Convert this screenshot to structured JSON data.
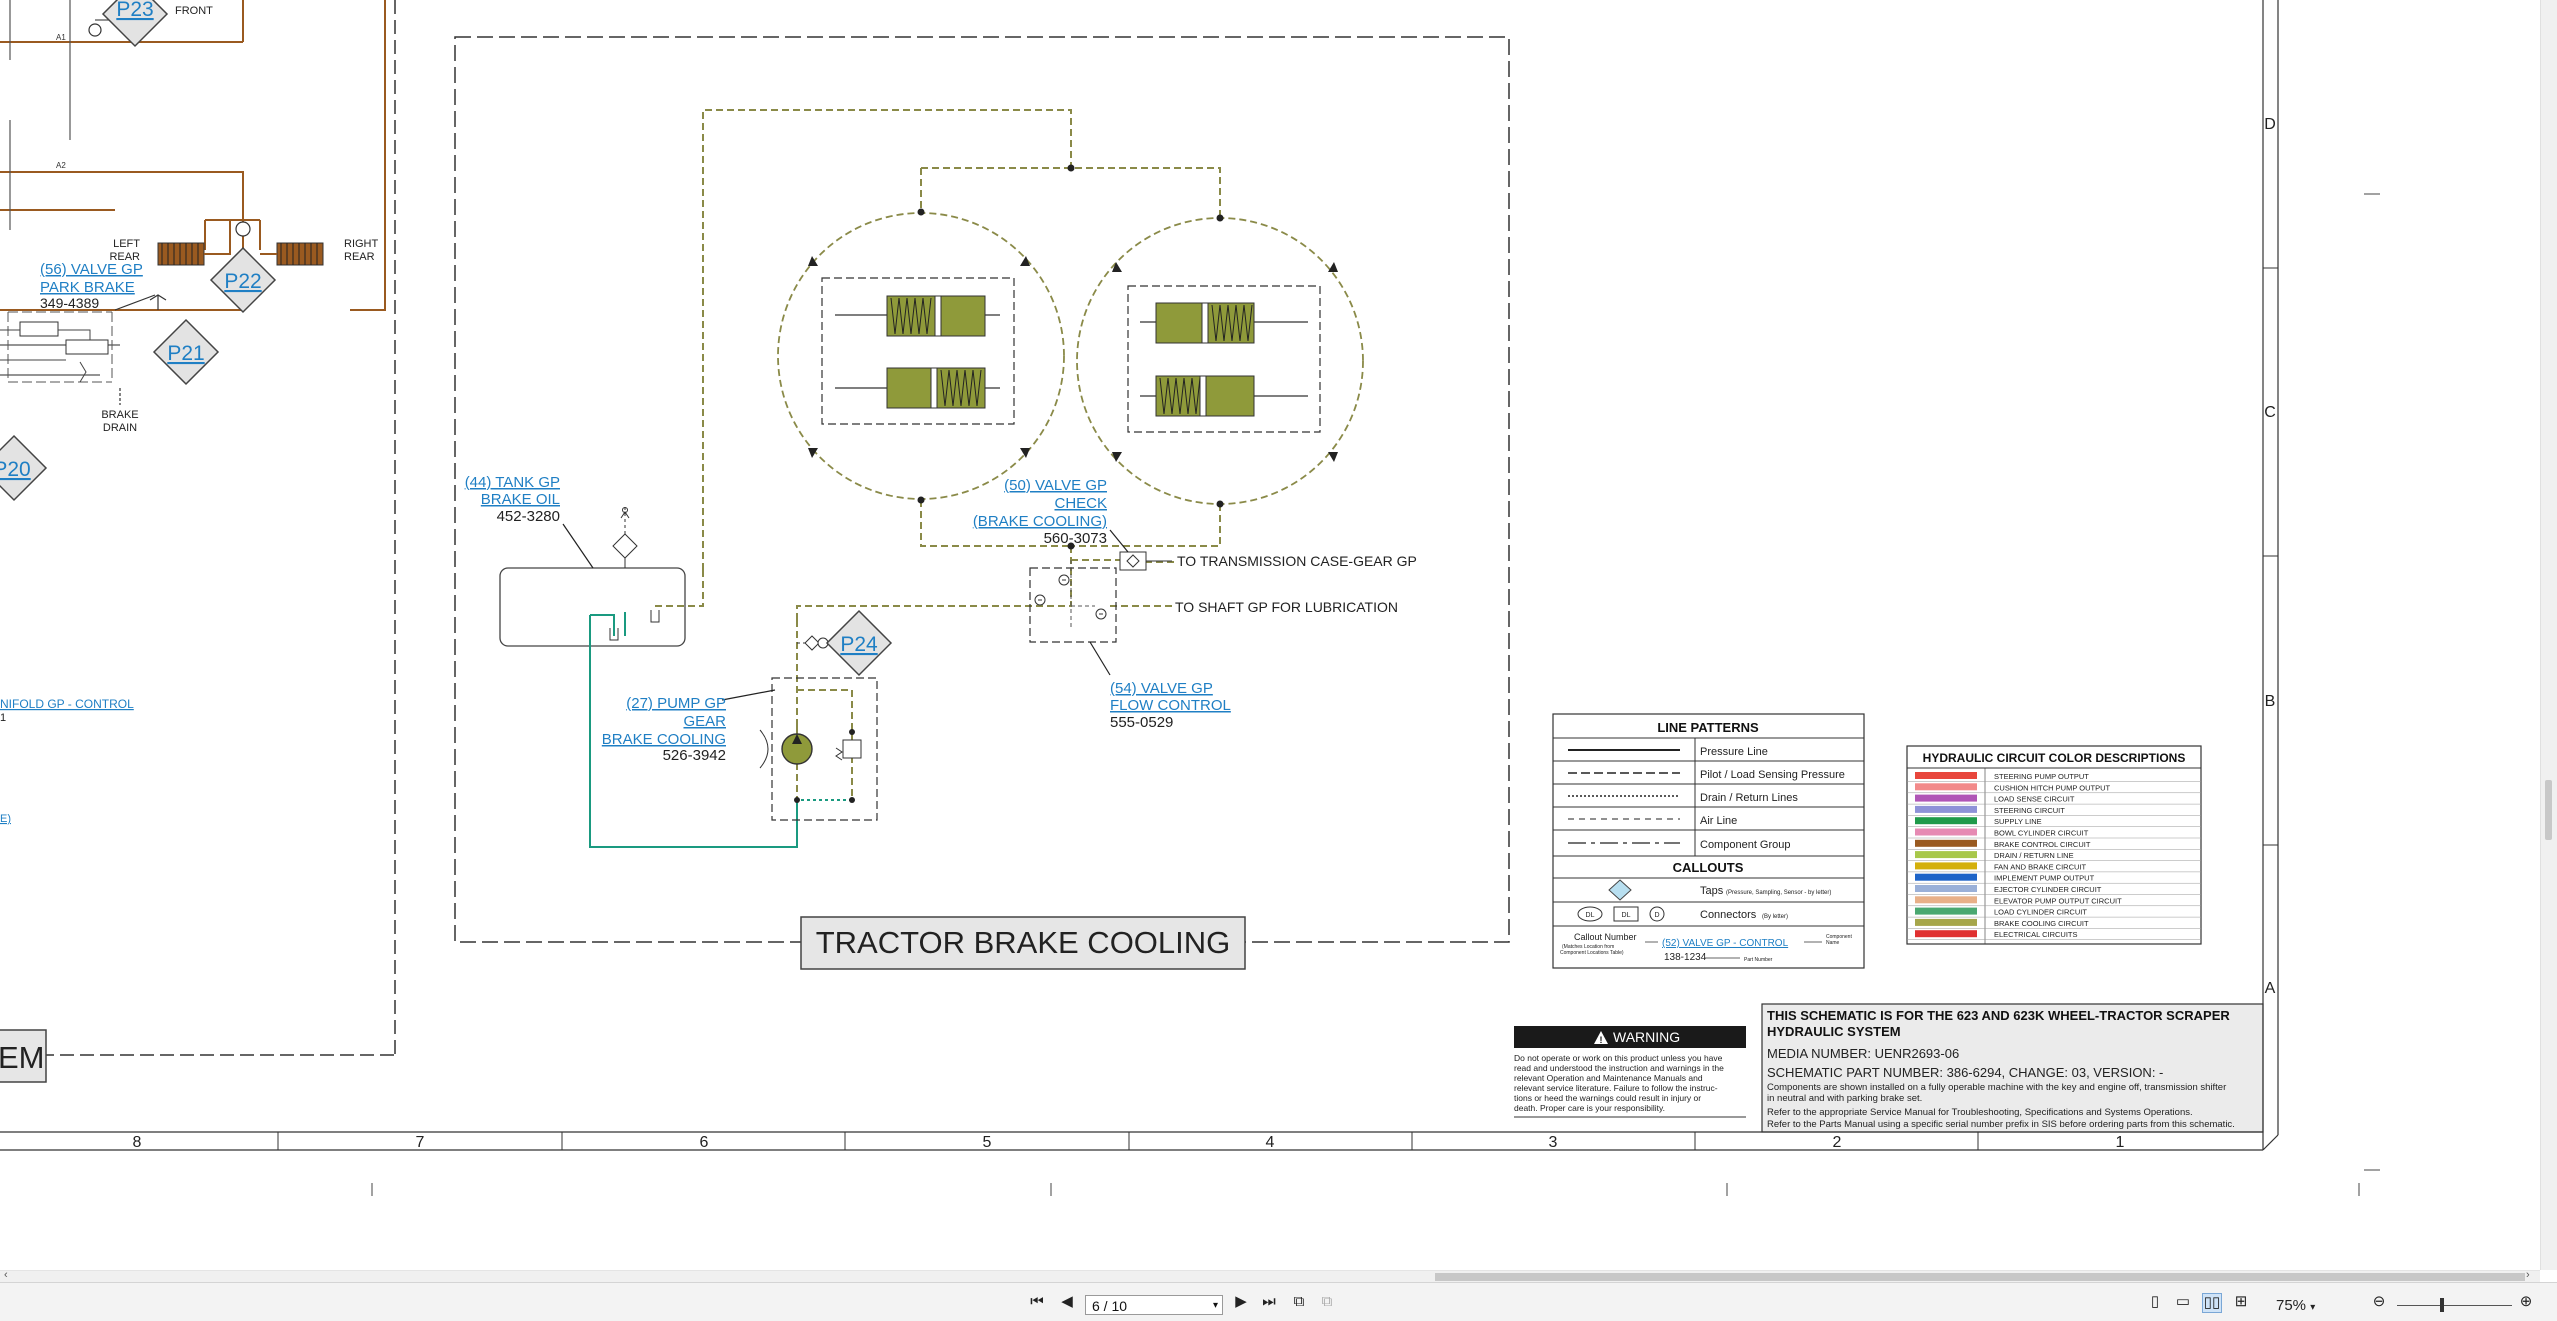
{
  "schematic": {
    "title_box": "TRACTOR BRAKE COOLING",
    "left_fragment_label": "EM",
    "taps": {
      "p23": "P23",
      "p22": "P22",
      "p21": "P21",
      "p20": "P20",
      "p24": "P24"
    },
    "left_side": {
      "front": "FRONT",
      "left_rear": [
        "LEFT",
        "REAR"
      ],
      "right_rear": [
        "RIGHT",
        "REAR"
      ],
      "valve_park_brake": [
        "(56) VALVE GP",
        "PARK BRAKE"
      ],
      "valve_park_brake_part": "349-4389",
      "brake_drain": [
        "BRAKE",
        "DRAIN"
      ],
      "manifold_link": "NIFOLD GP - CONTROL",
      "manifold_suffix": "1",
      "link_fragment": "E)",
      "wire_tags": [
        "A1",
        "A2"
      ]
    },
    "components": {
      "tank": {
        "lines": [
          "(44) TANK GP",
          "BRAKE OIL"
        ],
        "part": "452-3280"
      },
      "check_valve": {
        "lines": [
          "(50) VALVE GP",
          "CHECK",
          "(BRAKE COOLING)"
        ],
        "part": "560-3073"
      },
      "pump": {
        "lines": [
          "(27) PUMP GP",
          "GEAR",
          "BRAKE COOLING"
        ],
        "part": "526-3942"
      },
      "flow_valve": {
        "lines": [
          "(54) VALVE GP",
          "FLOW CONTROL"
        ],
        "part": "555-0529"
      }
    },
    "destinations": {
      "transmission": "TO TRANSMISSION CASE-GEAR GP",
      "shaft": "TO SHAFT GP FOR LUBRICATION"
    },
    "line_patterns": {
      "title": "LINE PATTERNS",
      "rows": [
        "Pressure Line",
        "Pilot / Load Sensing Pressure",
        "Drain / Return Lines",
        "Air Line",
        "Component Group"
      ],
      "callouts_title": "CALLOUTS",
      "taps_label": "Taps",
      "taps_note": "(Pressure, Sampling, Sensor - by letter)",
      "connectors_label": "Connectors",
      "connectors_note": "(By letter)",
      "connector_tags": [
        "DL",
        "DL",
        "D"
      ],
      "callout_number": "Callout Number",
      "callout_number_note": [
        "(Matches Location from",
        "Component Locations Table)"
      ],
      "callout_example": "(52) VALVE GP - CONTROL",
      "callout_part": "138-1234",
      "part_number_label": "Part Number",
      "component_name_label": [
        "Component",
        "Name"
      ]
    },
    "color_descriptions": {
      "title": "HYDRAULIC CIRCUIT COLOR DESCRIPTIONS",
      "items": [
        {
          "label": "STEERING PUMP OUTPUT",
          "color": "#e8463c"
        },
        {
          "label": "CUSHION HITCH PUMP OUTPUT",
          "color": "#f28a8a"
        },
        {
          "label": "LOAD SENSE CIRCUIT",
          "color": "#b056b6"
        },
        {
          "label": "STEERING CIRCUIT",
          "color": "#8e92d8"
        },
        {
          "label": "SUPPLY LINE",
          "color": "#1f9a4a"
        },
        {
          "label": "BOWL CYLINDER CIRCUIT",
          "color": "#e68ab3"
        },
        {
          "label": "BRAKE CONTROL CIRCUIT",
          "color": "#9a5a20"
        },
        {
          "label": "DRAIN / RETURN LINE",
          "color": "#a8c84a"
        },
        {
          "label": "FAN AND BRAKE CIRCUIT",
          "color": "#d4b00c"
        },
        {
          "label": "IMPLEMENT PUMP OUTPUT",
          "color": "#1e64c8"
        },
        {
          "label": "EJECTOR CYLINDER CIRCUIT",
          "color": "#9ab0d8"
        },
        {
          "label": "ELEVATOR PUMP OUTPUT CIRCUIT",
          "color": "#e8b088"
        },
        {
          "label": "LOAD CYLINDER CIRCUIT",
          "color": "#4aa870"
        },
        {
          "label": "BRAKE COOLING CIRCUIT",
          "color": "#a6a64a"
        },
        {
          "label": "ELECTRICAL CIRCUITS",
          "color": "#e03030"
        }
      ]
    },
    "warning": {
      "title": "WARNING",
      "lines": [
        "Do not operate or work on this product unless you have",
        "read and understood the instruction and warnings in the",
        "relevant Operation and Maintenance Manuals and",
        "relevant service literature. Failure to follow the instruc-",
        "tions or heed the warnings could result in injury or",
        "death. Proper care is your responsibility."
      ]
    },
    "info_block": {
      "heading": [
        "THIS SCHEMATIC IS FOR THE 623 AND 623K WHEEL-TRACTOR SCRAPER",
        "HYDRAULIC SYSTEM"
      ],
      "media": "MEDIA NUMBER: UENR2693-06",
      "schematic_part": "SCHEMATIC PART NUMBER: 386-6294, CHANGE: 03, VERSION: -",
      "notes": [
        "Components are shown installed on a fully operable machine with the key and engine off, transmission shifter",
        "in neutral and with parking brake set.",
        "Refer to the appropriate Service Manual for Troubleshooting, Specifications and Systems Operations.",
        "Refer to the Parts Manual using a specific serial number prefix in SIS before ordering parts from this schematic."
      ]
    },
    "zone_columns": [
      "8",
      "7",
      "6",
      "5",
      "4",
      "3",
      "2",
      "1"
    ],
    "zone_rows": [
      "D",
      "C",
      "B",
      "A"
    ]
  },
  "viewer": {
    "page_field": "6 / 10",
    "zoom": "75%"
  }
}
